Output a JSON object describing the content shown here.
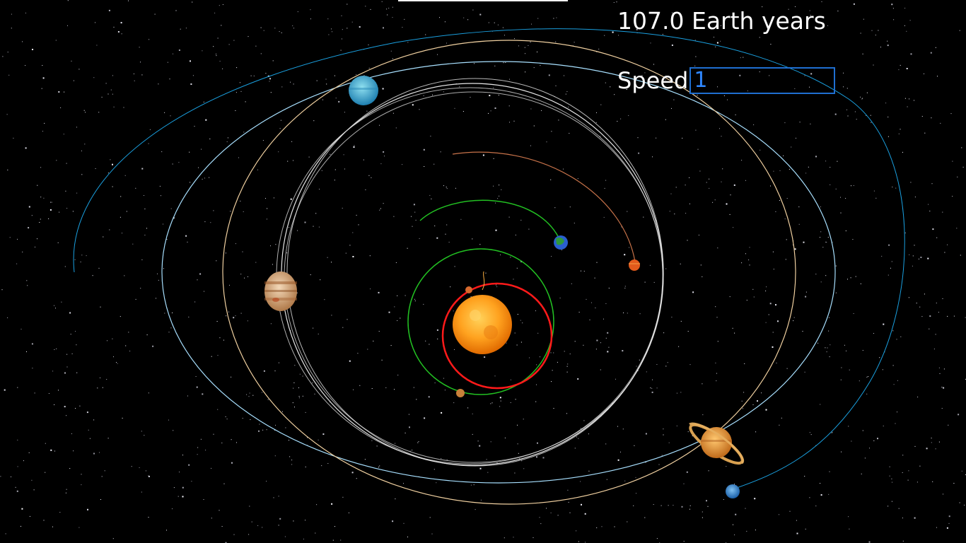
{
  "hud": {
    "time_readout": "107.0 Earth years",
    "speed_label": "Speed",
    "speed_value": "1"
  },
  "bodies": [
    {
      "name": "sun",
      "icon": "sun-icon",
      "color": "#ff9a1a"
    },
    {
      "name": "mercury",
      "icon": "mercury-icon",
      "color": "#d86a2e"
    },
    {
      "name": "venus",
      "icon": "venus-icon",
      "color": "#c9803a"
    },
    {
      "name": "earth",
      "icon": "earth-icon",
      "color": "#2e8a3a"
    },
    {
      "name": "mars",
      "icon": "mars-icon",
      "color": "#e25a1c"
    },
    {
      "name": "jupiter",
      "icon": "jupiter-icon",
      "color": "#d8a57a"
    },
    {
      "name": "saturn",
      "icon": "saturn-icon",
      "color": "#e89a3a"
    },
    {
      "name": "uranus",
      "icon": "uranus-icon",
      "color": "#3ab0d8"
    },
    {
      "name": "neptune",
      "icon": "neptune-icon",
      "color": "#3a8fd8"
    }
  ],
  "orbit_colors": {
    "mercury": "#ff1a1a",
    "venus": "#22c022",
    "earth": "#22c022",
    "mars": "#c8734a",
    "jupiter": "#e8e8e8",
    "saturn": "#f0d0a0",
    "uranus": "#a8e0ff",
    "neptune": "#1aa0e0"
  }
}
